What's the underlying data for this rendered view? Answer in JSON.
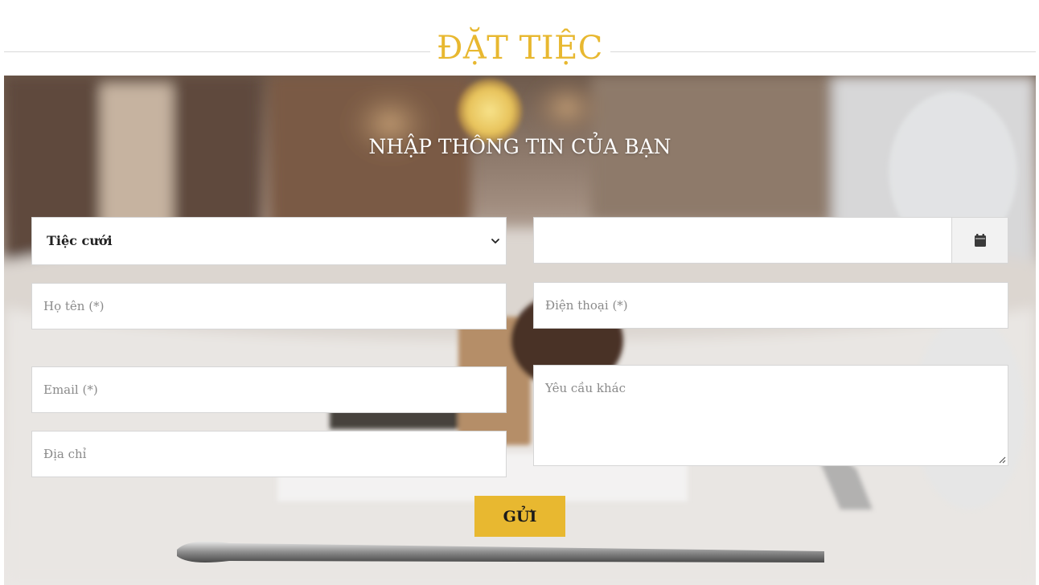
{
  "section": {
    "title": "ĐẶT TIỆC"
  },
  "form": {
    "heading": "NHẬP THÔNG TIN CỦA BẠN",
    "party_type": {
      "selected": "Tiệc cưới"
    },
    "date": {
      "value": "",
      "icon": "calendar-icon"
    },
    "name": {
      "placeholder": "Họ tên (*)"
    },
    "phone": {
      "placeholder": "Điện thoại (*)"
    },
    "email": {
      "placeholder": "Email (*)"
    },
    "address": {
      "placeholder": "Địa chỉ"
    },
    "notes": {
      "placeholder": "Yêu cầu khác"
    },
    "submit_label": "GỬI"
  },
  "colors": {
    "accent": "#e8b830",
    "heading_white": "#ffffff",
    "rule": "#d9d9d9"
  }
}
